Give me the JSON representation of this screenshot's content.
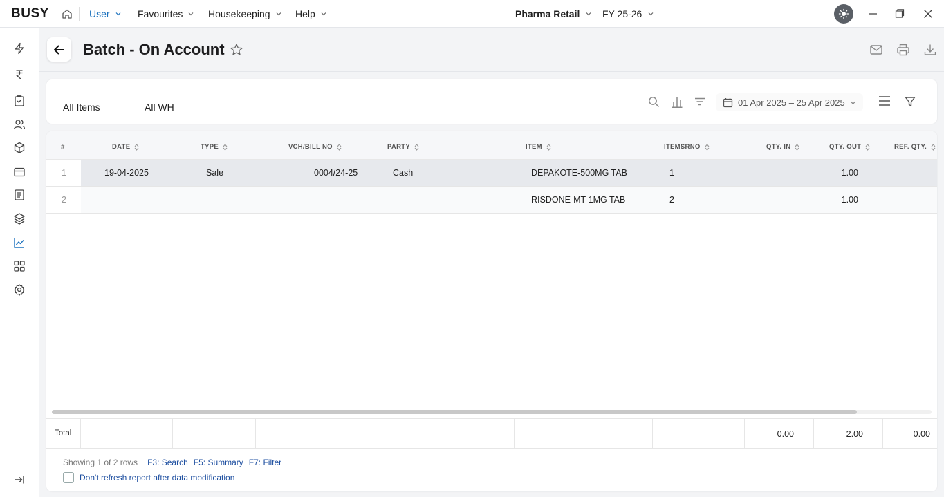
{
  "app": {
    "logo": "BUSY"
  },
  "topmenu": {
    "items": [
      {
        "label": "User",
        "active": true
      },
      {
        "label": "Favourites",
        "active": false
      },
      {
        "label": "Housekeeping",
        "active": false
      },
      {
        "label": "Help",
        "active": false
      }
    ],
    "company": "Pharma Retail",
    "fy": "FY 25-26"
  },
  "sidebar": {
    "icons": [
      "lightning-icon",
      "rupee-icon",
      "clipboard-icon",
      "users-icon",
      "cube-icon",
      "card-icon",
      "document-icon",
      "layers-icon",
      "chart-line-icon",
      "grid-icon",
      "gear-icon"
    ],
    "active": "chart-line-icon"
  },
  "header": {
    "title": "Batch - On Account"
  },
  "filters": {
    "items_label": "All Items",
    "wh_label": "All WH",
    "date_range": "01 Apr 2025 – 25 Apr 2025"
  },
  "table": {
    "columns": {
      "num": "#",
      "date": "DATE",
      "type": "TYPE",
      "vch": "VCH/BILL NO",
      "party": "PARTY",
      "item": "ITEM",
      "itemsrno": "ITEMSRNO",
      "qty_in": "QTY. IN",
      "qty_out": "QTY. OUT",
      "ref_qty": "REF. QTY."
    },
    "rows": [
      {
        "num": "1",
        "date": "19-04-2025",
        "type": "Sale",
        "vch": "0004/24-25",
        "party": "Cash",
        "item": "DEPAKOTE-500MG TAB",
        "itemsrno": "1",
        "qty_in": "",
        "qty_out": "1.00",
        "ref_qty": ""
      },
      {
        "num": "2",
        "date": "",
        "type": "",
        "vch": "",
        "party": "",
        "item": "RISDONE-MT-1MG TAB",
        "itemsrno": "2",
        "qty_in": "",
        "qty_out": "1.00",
        "ref_qty": ""
      }
    ],
    "total": {
      "label": "Total",
      "qty_in": "0.00",
      "qty_out": "2.00",
      "ref_qty": "0.00"
    }
  },
  "footer": {
    "showing": "Showing 1 of 2 rows",
    "shortcuts": [
      "F3: Search",
      "F5: Summary",
      "F7: Filter"
    ],
    "checkbox_label": "Don't refresh report after data modification"
  },
  "colors": {
    "accent": "#1e73be",
    "link": "#1e4fa0",
    "selected_row": "#e7e9ed"
  }
}
